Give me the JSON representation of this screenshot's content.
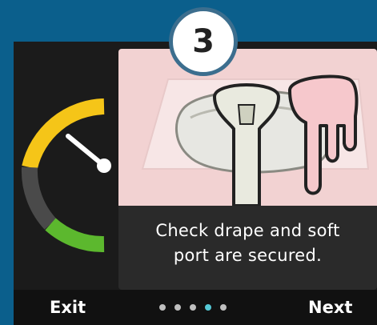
{
  "step": {
    "number": "3",
    "message_line1": "Check drape and soft",
    "message_line2": "port are secured."
  },
  "footer": {
    "exit_label": "Exit",
    "next_label": "Next",
    "pages": 5,
    "current_page": 4
  },
  "gauge": {
    "segments": [
      "yellow",
      "gray",
      "green"
    ],
    "colors": {
      "yellow": "#f5c518",
      "gray": "#4a4a4a",
      "green": "#5cb82e",
      "needle": "#ffffff"
    }
  },
  "colors": {
    "background": "#0b5f8c",
    "panel": "#1b1b1b",
    "illustration_bg": "#f2d2d2",
    "active_dot": "#55c9d6",
    "inactive_dot": "#bfbfbf"
  }
}
